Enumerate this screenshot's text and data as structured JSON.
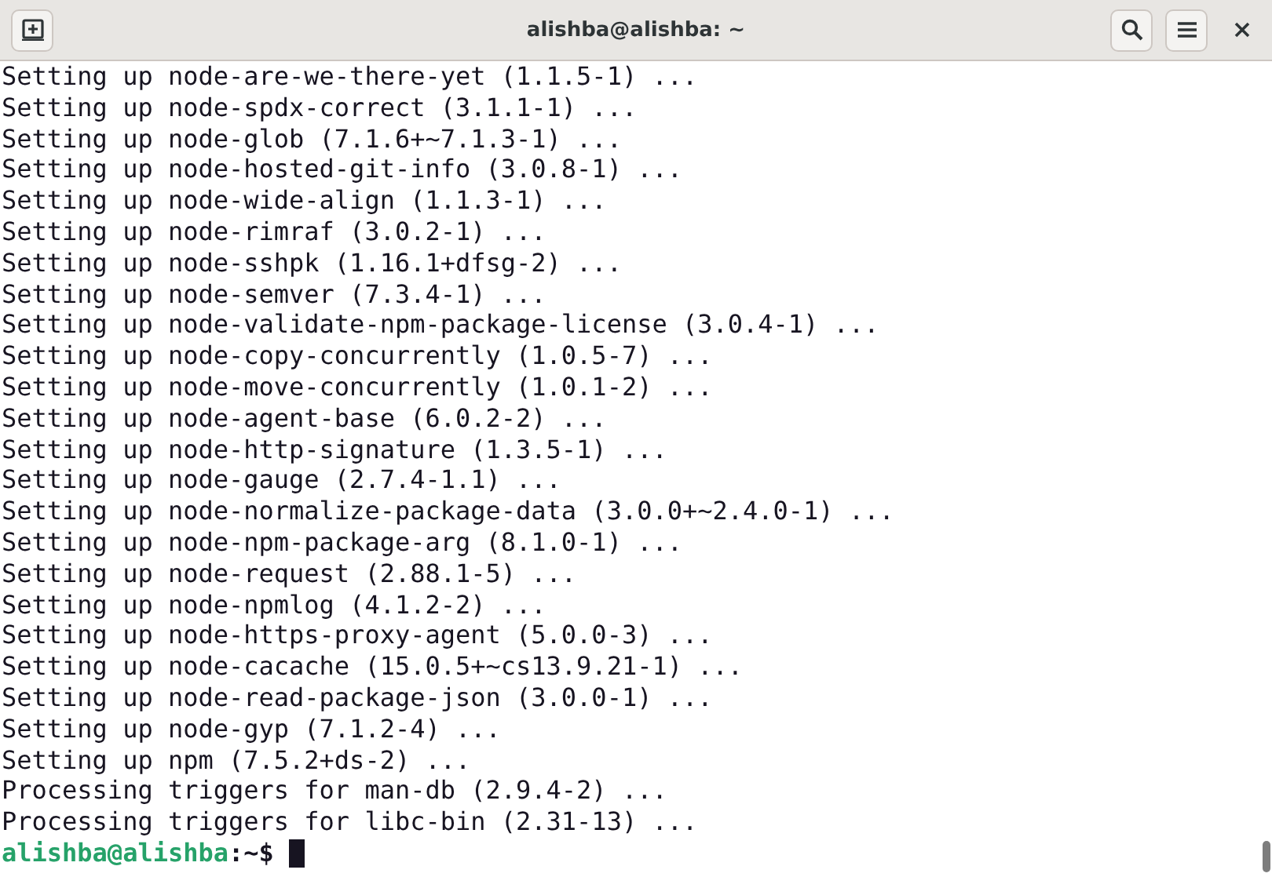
{
  "window": {
    "title": "alishba@alishba: ~"
  },
  "terminal": {
    "lines": [
      "Setting up node-are-we-there-yet (1.1.5-1) ...",
      "Setting up node-spdx-correct (3.1.1-1) ...",
      "Setting up node-glob (7.1.6+~7.1.3-1) ...",
      "Setting up node-hosted-git-info (3.0.8-1) ...",
      "Setting up node-wide-align (1.1.3-1) ...",
      "Setting up node-rimraf (3.0.2-1) ...",
      "Setting up node-sshpk (1.16.1+dfsg-2) ...",
      "Setting up node-semver (7.3.4-1) ...",
      "Setting up node-validate-npm-package-license (3.0.4-1) ...",
      "Setting up node-copy-concurrently (1.0.5-7) ...",
      "Setting up node-move-concurrently (1.0.1-2) ...",
      "Setting up node-agent-base (6.0.2-2) ...",
      "Setting up node-http-signature (1.3.5-1) ...",
      "Setting up node-gauge (2.7.4-1.1) ...",
      "Setting up node-normalize-package-data (3.0.0+~2.4.0-1) ...",
      "Setting up node-npm-package-arg (8.1.0-1) ...",
      "Setting up node-request (2.88.1-5) ...",
      "Setting up node-npmlog (4.1.2-2) ...",
      "Setting up node-https-proxy-agent (5.0.0-3) ...",
      "Setting up node-cacache (15.0.5+~cs13.9.21-1) ...",
      "Setting up node-read-package-json (3.0.0-1) ...",
      "Setting up node-gyp (7.1.2-4) ...",
      "Setting up npm (7.5.2+ds-2) ...",
      "Processing triggers for man-db (2.9.4-2) ...",
      "Processing triggers for libc-bin (2.31-13) ..."
    ],
    "prompt": {
      "user_host": "alishba@alishba",
      "path": ":~$"
    }
  }
}
